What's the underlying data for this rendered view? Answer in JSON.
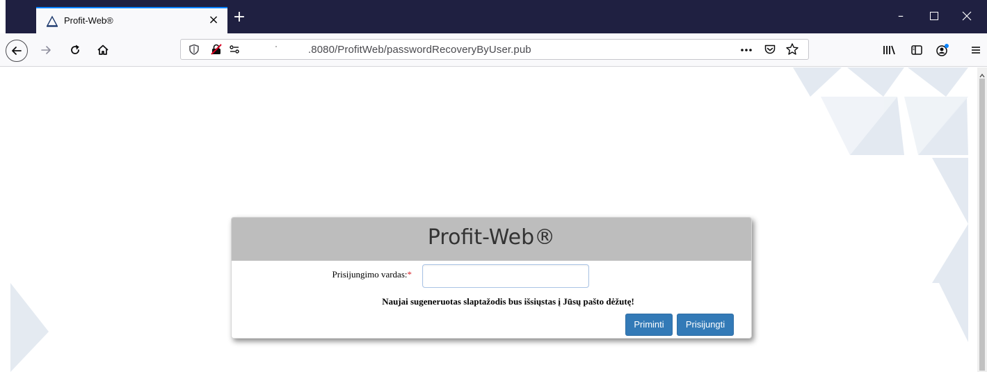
{
  "browser": {
    "tab_title": "Profit-Web®",
    "tab_close": "×",
    "new_tab": "+",
    "url": ".8080/ProfitWeb/passwordRecoveryByUser.pub",
    "window_controls": {
      "minimize": "–",
      "maximize": "☐",
      "close": "✕"
    },
    "icons": [
      "back-icon",
      "forward-icon",
      "reload-icon",
      "home-icon",
      "shield-icon",
      "insecure-lock-icon",
      "permissions-icon",
      "page-actions-icon",
      "pocket-icon",
      "bookmark-star-icon",
      "library-icon",
      "sidebar-icon",
      "account-icon",
      "menu-icon"
    ]
  },
  "page": {
    "card_title": "Profit-Web®",
    "username_label": "Prisijungimo vardas:",
    "required_mark": "*",
    "username_value": "",
    "notice": "Naujai sugeneruotas slaptažodis bus išsiųstas į Jūsų pašto dėžutę!",
    "remind_button": "Priminti",
    "login_button": "Prisijungti"
  },
  "colors": {
    "tabbar": "#1f2041",
    "accent": "#0a84ff",
    "card_header": "#bdbdbd",
    "button": "#337ab7",
    "required": "#d9262d",
    "bg_triangles": "#dfe6ef"
  }
}
